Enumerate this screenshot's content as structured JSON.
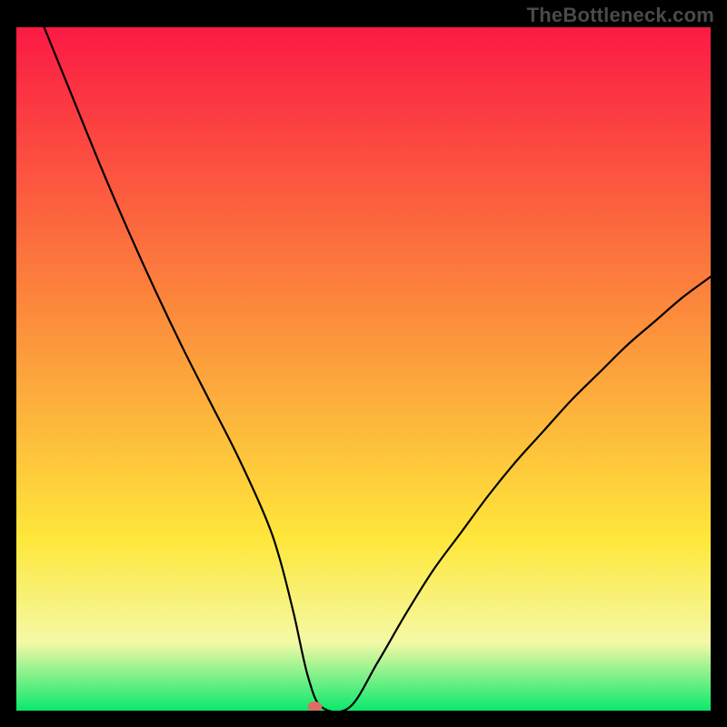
{
  "watermark": "TheBottleneck.com",
  "chart_data": {
    "type": "line",
    "title": "",
    "xlabel": "",
    "ylabel": "",
    "xlim": [
      0,
      100
    ],
    "ylim": [
      0,
      100
    ],
    "legend": false,
    "annotations": [],
    "background": {
      "gradient_stops": [
        "#fb1a44",
        "#fc863c",
        "#fee73b",
        "#f4f9a6",
        "#0ae86c"
      ],
      "gradient_positions": [
        0,
        40,
        75,
        90,
        100
      ]
    },
    "series": [
      {
        "name": "bottleneck-curve",
        "x": [
          4,
          8,
          12,
          16,
          20,
          24,
          28,
          32,
          36,
          38,
          40,
          42,
          44,
          48,
          52,
          56,
          60,
          64,
          68,
          72,
          76,
          80,
          84,
          88,
          92,
          96,
          100
        ],
        "values": [
          100,
          90,
          80,
          70.5,
          61.5,
          53,
          45,
          37,
          28,
          22,
          14,
          5,
          0.5,
          0.5,
          7,
          14,
          20.5,
          26,
          31.5,
          36.5,
          41,
          45.5,
          49.5,
          53.5,
          57,
          60.5,
          63.5
        ]
      }
    ],
    "flat_segment": {
      "x0": 40,
      "x1": 44,
      "y": 0.5
    },
    "marker": {
      "x": 43,
      "y": 0.6,
      "color": "#db6e62"
    }
  }
}
